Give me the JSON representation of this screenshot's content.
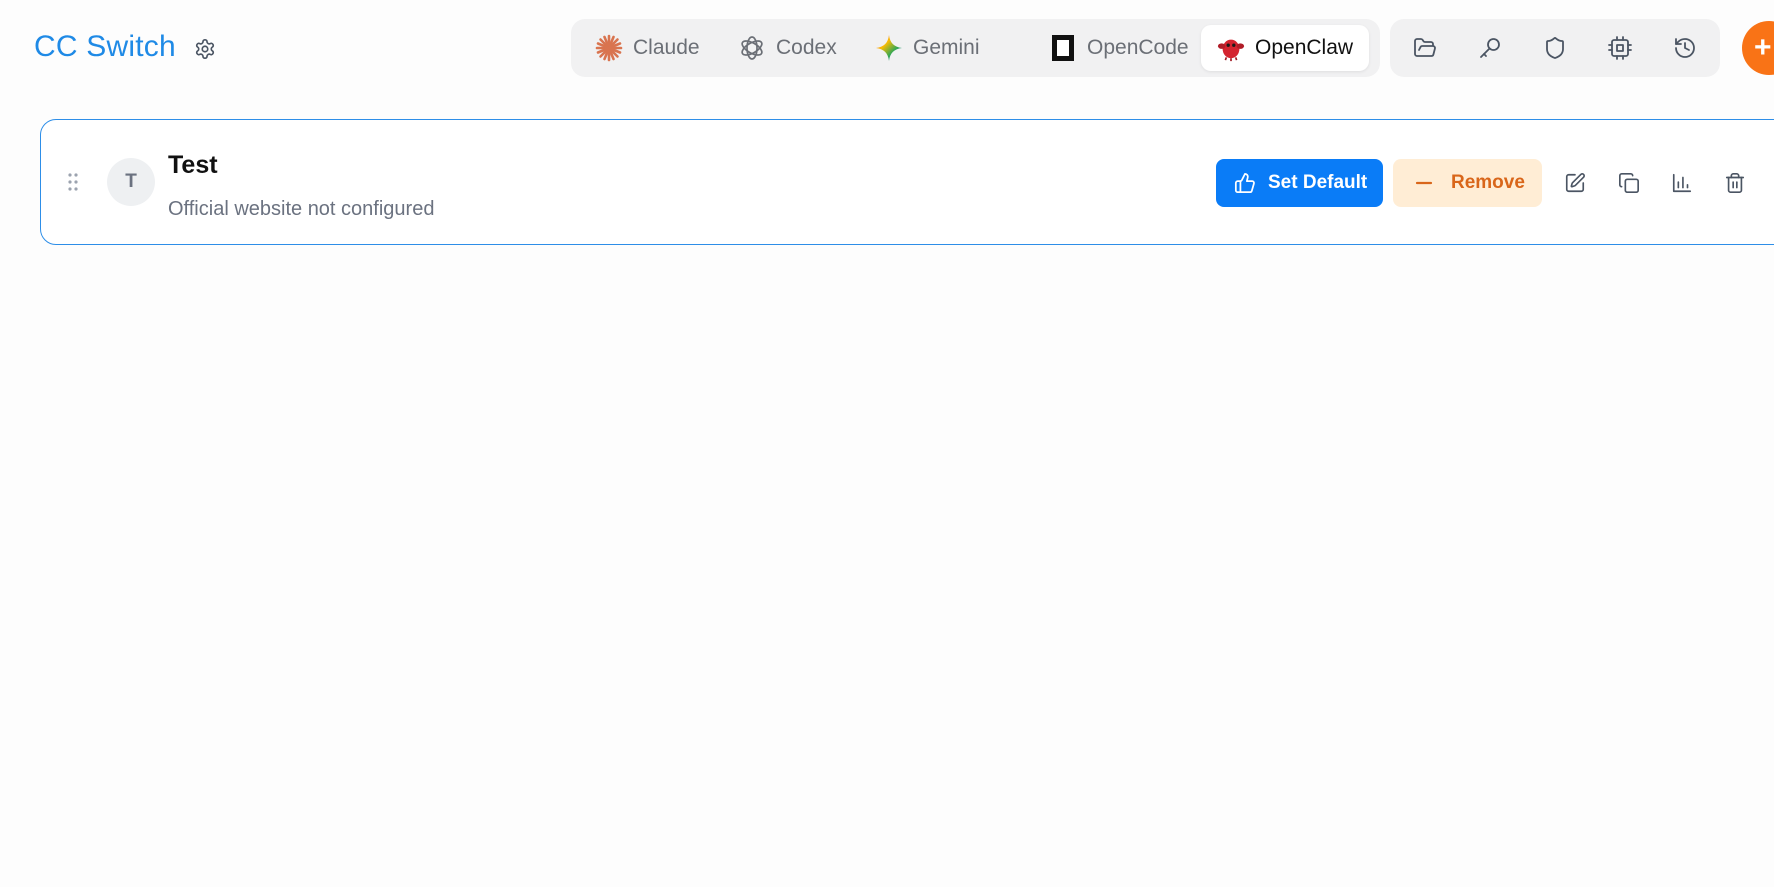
{
  "header": {
    "brand": "CC Switch",
    "settings_icon": "gear-icon",
    "add_icon": "plus-icon"
  },
  "app_tabs": [
    {
      "label": "Claude",
      "icon": "claude-icon",
      "active": false
    },
    {
      "label": "Codex",
      "icon": "openai-icon",
      "active": false
    },
    {
      "label": "Gemini",
      "icon": "gemini-icon",
      "active": false
    },
    {
      "label": "OpenCode",
      "icon": "opencode-icon",
      "active": false
    },
    {
      "label": "OpenClaw",
      "icon": "openclaw-icon",
      "active": true
    }
  ],
  "toolbar": [
    {
      "icon": "folder-open-icon"
    },
    {
      "icon": "key-icon"
    },
    {
      "icon": "shield-icon"
    },
    {
      "icon": "cpu-icon"
    },
    {
      "icon": "history-icon"
    }
  ],
  "provider": {
    "avatar_letter": "T",
    "name": "Test",
    "website": "Official website not configured",
    "set_default_label": "Set Default",
    "remove_label": "Remove",
    "actions": [
      {
        "icon": "edit-icon"
      },
      {
        "icon": "copy-icon"
      },
      {
        "icon": "bar-chart-icon"
      },
      {
        "icon": "trash-icon"
      }
    ]
  },
  "colors": {
    "brand": "#1f8ae6",
    "primary_button": "#0a7cf7",
    "remove_bg": "#ffedd5",
    "remove_text": "#d9661a",
    "add_button": "#f97316",
    "card_border": "#2d8ee8"
  }
}
